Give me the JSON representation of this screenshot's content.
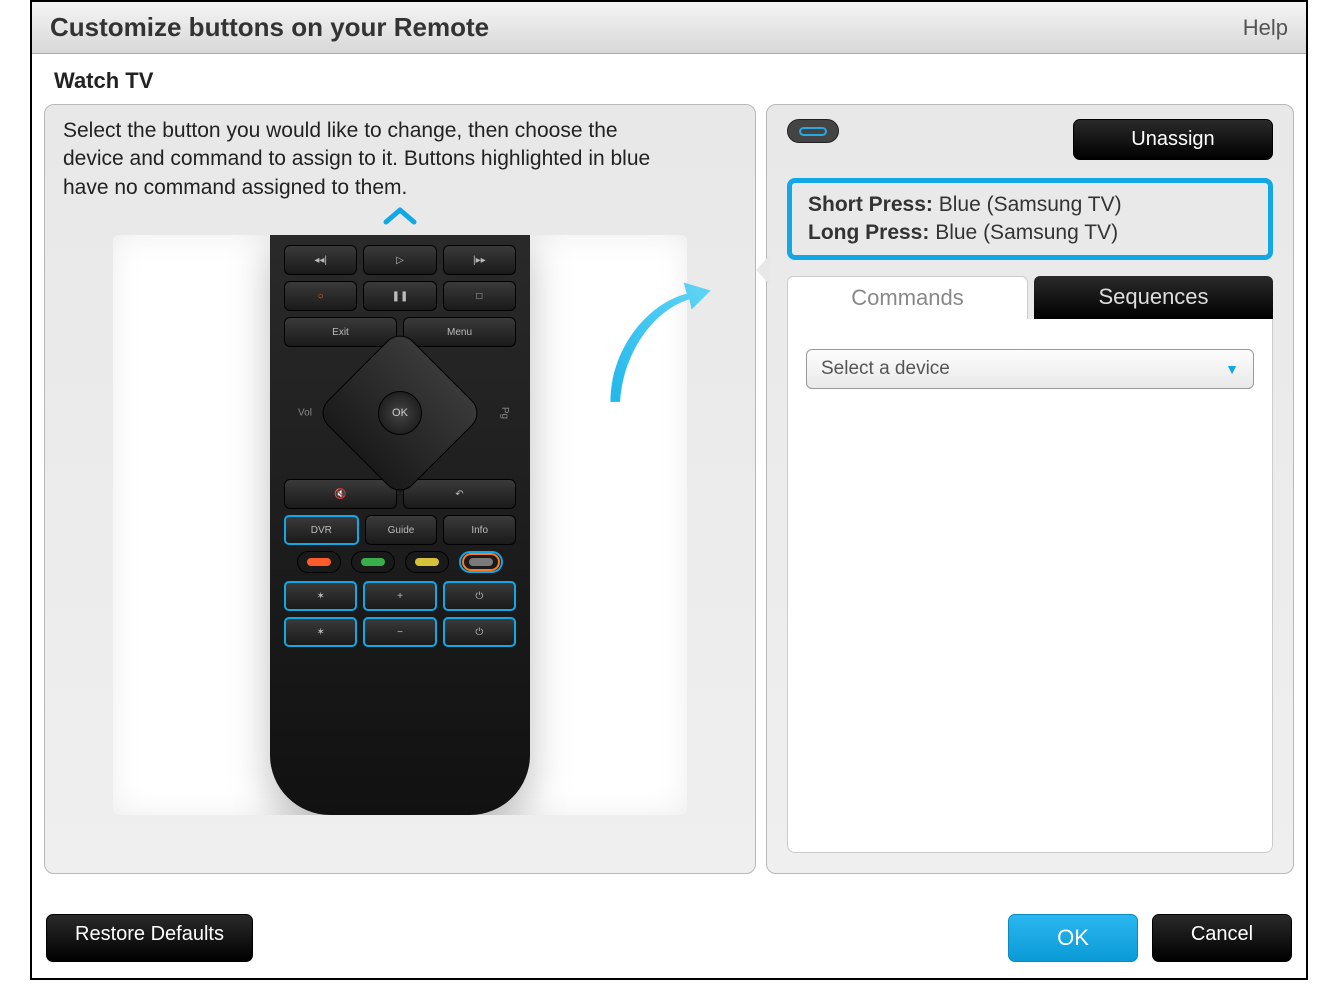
{
  "window": {
    "title": "Customize buttons on your Remote",
    "help": "Help"
  },
  "activity": "Watch TV",
  "instructions": "Select the button you would like to change, then choose the device and command to assign to it. Buttons highlighted in blue have no command assigned to them.",
  "remote": {
    "rec_label": "",
    "exit": "Exit",
    "menu": "Menu",
    "ok": "OK",
    "vol": "Vol",
    "pg": "Pg",
    "dvr": "DVR",
    "guide": "Guide",
    "info": "Info"
  },
  "rightPanel": {
    "unassign": "Unassign",
    "shortPress": {
      "label": "Short Press:",
      "value": "Blue (Samsung TV)"
    },
    "longPress": {
      "label": "Long Press:",
      "value": "Blue (Samsung TV)"
    },
    "tabs": {
      "commands": "Commands",
      "sequences": "Sequences"
    },
    "deviceSelect": "Select a device"
  },
  "footer": {
    "restore": "Restore Defaults",
    "ok": "OK",
    "cancel": "Cancel"
  }
}
